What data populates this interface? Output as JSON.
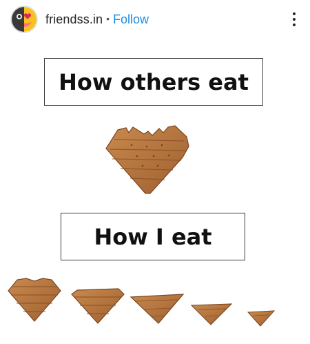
{
  "header": {
    "account_name": "friendss.in",
    "separator": "•",
    "follow_label": "Follow"
  },
  "post": {
    "caption_top": "How others eat",
    "caption_bottom": "How I eat"
  },
  "colors": {
    "follow_blue": "#1a8fe0",
    "snack_brown": "#b9743d",
    "snack_dark": "#7a4522"
  },
  "icons": {
    "avatar": "emoji-avatar-icon",
    "more": "more-options-icon"
  }
}
